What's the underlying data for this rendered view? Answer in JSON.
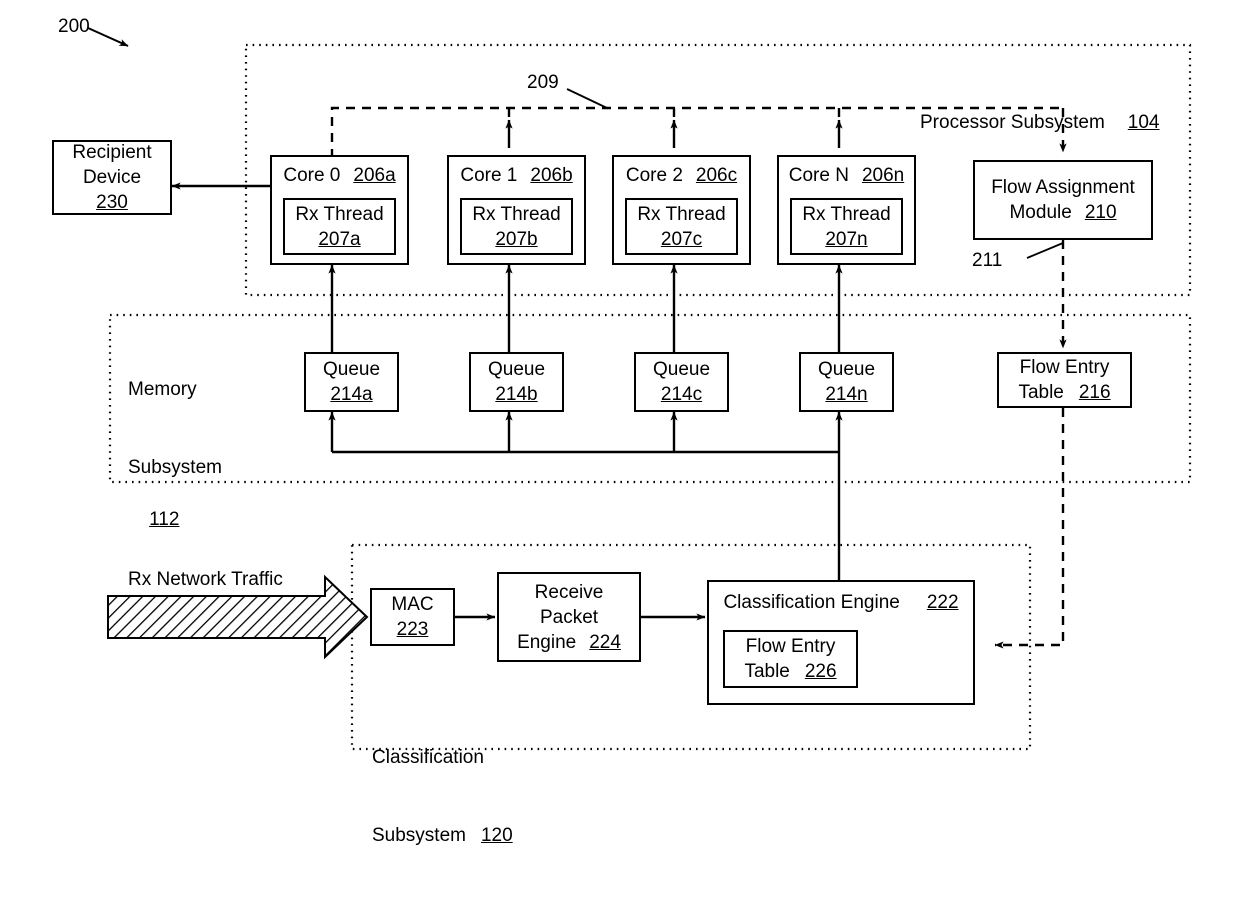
{
  "figure": {
    "number": "200",
    "bus_label": "209",
    "flow_link_label": "211"
  },
  "processor_subsystem": {
    "title": "Processor Subsystem",
    "ref": "104",
    "cores": [
      {
        "name": "Core 0",
        "ref": "206a",
        "thread_name": "Rx Thread",
        "thread_ref": "207a"
      },
      {
        "name": "Core 1",
        "ref": "206b",
        "thread_name": "Rx Thread",
        "thread_ref": "207b"
      },
      {
        "name": "Core 2",
        "ref": "206c",
        "thread_name": "Rx Thread",
        "thread_ref": "207c"
      },
      {
        "name": "Core N",
        "ref": "206n",
        "thread_name": "Rx Thread",
        "thread_ref": "207n"
      }
    ],
    "flow_assignment": {
      "line1": "Flow Assignment",
      "line2": "Module",
      "ref": "210"
    }
  },
  "recipient_device": {
    "line1": "Recipient",
    "line2": "Device",
    "ref": "230"
  },
  "memory_subsystem": {
    "line1": "Memory",
    "line2": "Subsystem",
    "ref": "112",
    "queues": [
      {
        "name": "Queue",
        "ref": "214a"
      },
      {
        "name": "Queue",
        "ref": "214b"
      },
      {
        "name": "Queue",
        "ref": "214c"
      },
      {
        "name": "Queue",
        "ref": "214n"
      }
    ],
    "flow_entry_table": {
      "line1": "Flow Entry",
      "line2": "Table",
      "ref": "216"
    }
  },
  "classification_subsystem": {
    "line1": "Classification",
    "line2": "Subsystem",
    "ref": "120",
    "traffic_label": "Rx Network Traffic",
    "mac": {
      "name": "MAC",
      "ref": "223"
    },
    "receive_packet_engine": {
      "line1": "Receive",
      "line2": "Packet",
      "line3": "Engine",
      "ref": "224"
    },
    "classification_engine": {
      "name": "Classification Engine",
      "ref": "222",
      "flow_entry_table": {
        "line1": "Flow Entry",
        "line2": "Table",
        "ref": "226"
      }
    }
  }
}
